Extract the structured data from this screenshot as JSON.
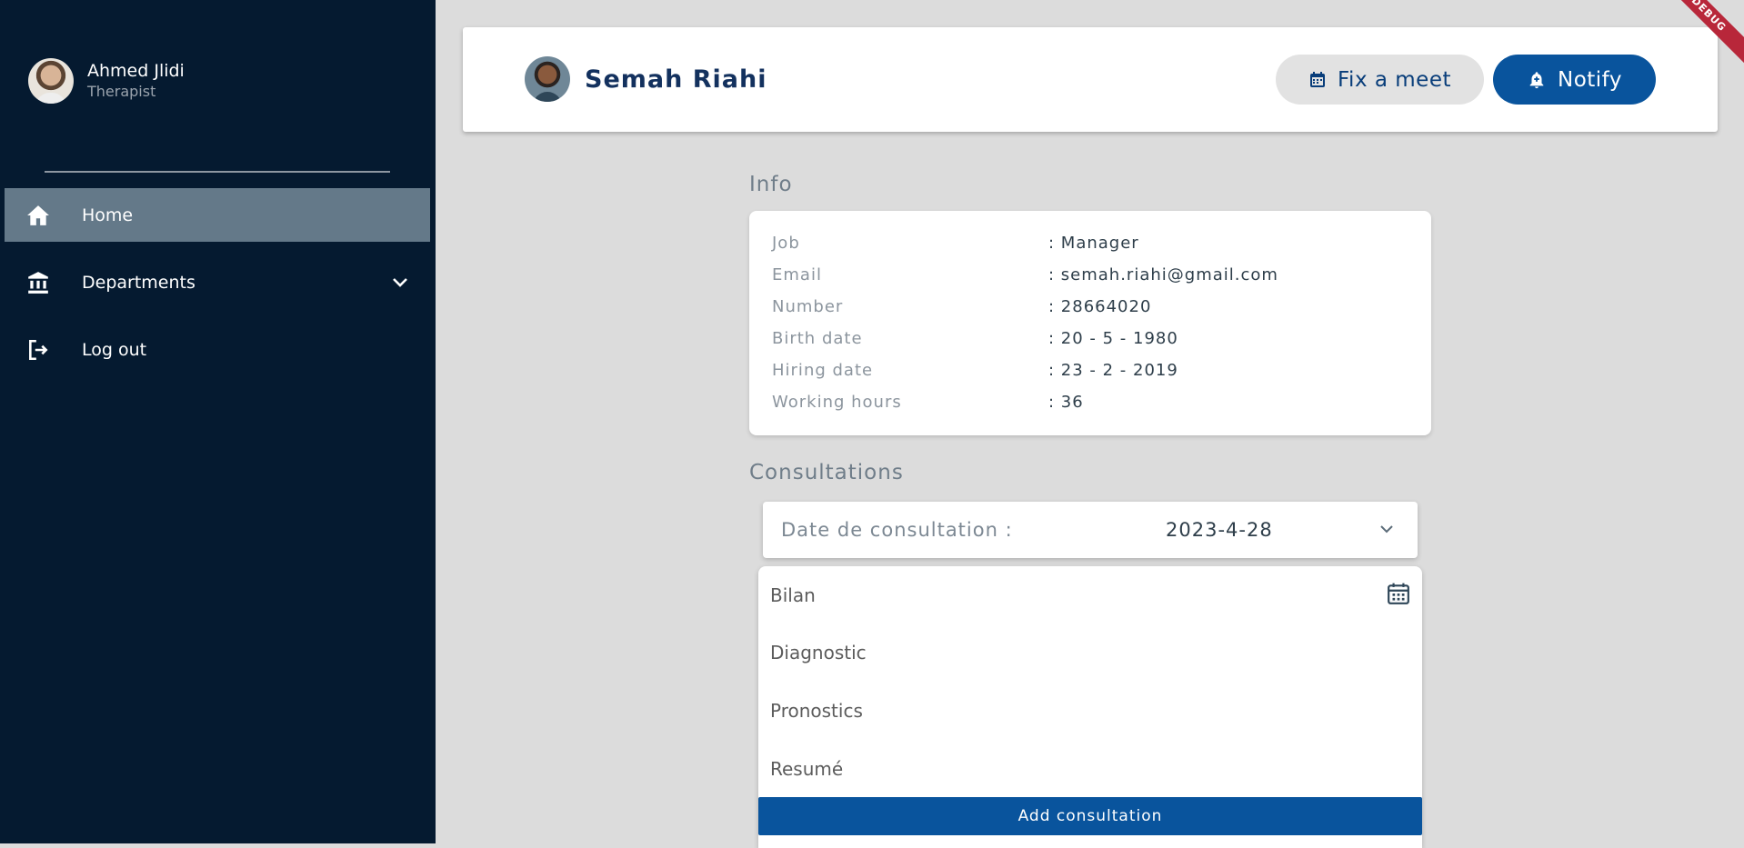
{
  "sidebar": {
    "user": {
      "name": "Ahmed Jlidi",
      "role": "Therapist"
    },
    "items": [
      {
        "label": "Home",
        "icon": "home-icon",
        "active": true
      },
      {
        "label": "Departments",
        "icon": "bank-icon",
        "expandable": true
      },
      {
        "label": "Log out",
        "icon": "logout-icon"
      }
    ]
  },
  "header": {
    "name": "Semah Riahi",
    "fix_meet_label": "Fix a meet",
    "notify_label": "Notify",
    "debug_label": "DEBUG"
  },
  "info": {
    "title": "Info",
    "rows": [
      {
        "label": "Job",
        "value": ": Manager"
      },
      {
        "label": "Email",
        "value": ": semah.riahi@gmail.com"
      },
      {
        "label": "Number",
        "value": ": 28664020"
      },
      {
        "label": "Birth date",
        "value": ": 20 - 5 - 1980"
      },
      {
        "label": "Hiring date",
        "value": ": 23 - 2 - 2019"
      },
      {
        "label": "Working hours",
        "value": ": 36"
      }
    ]
  },
  "consultations": {
    "title": "Consultations",
    "date_label": "Date de consultation :",
    "date_value": "2023-4-28",
    "items": [
      "Bilan",
      "Diagnostic",
      "Pronostics",
      "Resumé"
    ],
    "add_label": "Add consultation"
  },
  "colors": {
    "sidebar_bg": "#051a30",
    "active_item": "#647989",
    "primary": "#09549d",
    "debug": "#b8273a"
  }
}
